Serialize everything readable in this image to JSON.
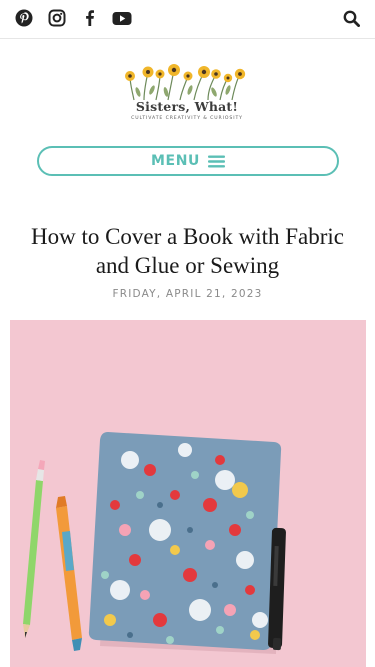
{
  "topbar": {
    "icons": [
      "pinterest-icon",
      "instagram-icon",
      "facebook-icon",
      "youtube-icon",
      "search-icon"
    ]
  },
  "logo": {
    "title": "Sisters, What!",
    "tagline": "CULTIVATE CREATIVITY & CURIOSITY"
  },
  "nav": {
    "menu_label": "MENU",
    "icon": "hamburger-icon"
  },
  "post": {
    "title": "How to Cover a Book with Fabric and Glue or Sewing",
    "date": "FRIDAY, APRIL 21, 2023"
  },
  "colors": {
    "accent": "#5bbfb5",
    "photo_background": "#f3c7d1",
    "fabric_blue": "#7b9cb8"
  }
}
